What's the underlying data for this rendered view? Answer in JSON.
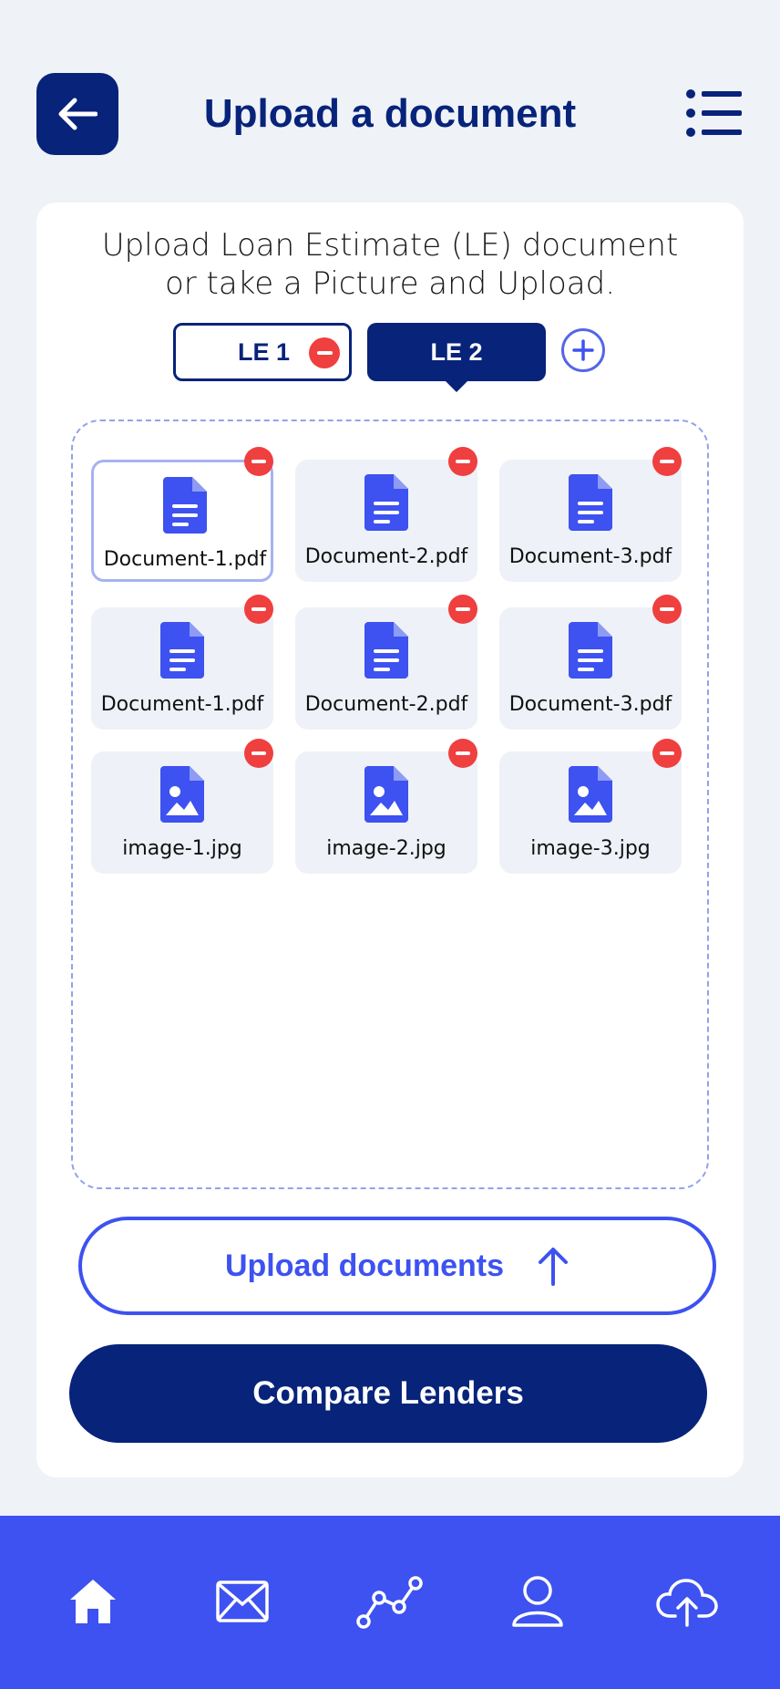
{
  "header": {
    "title": "Upload a document"
  },
  "card": {
    "instruction_line1": "Upload Loan Estimate (LE) document",
    "instruction_line2": "or take a Picture and Upload."
  },
  "tabs": [
    {
      "label": "LE 1",
      "active": false
    },
    {
      "label": "LE 2",
      "active": true
    }
  ],
  "files": [
    {
      "name": "Document-1.pdf",
      "type": "pdf",
      "selected": true
    },
    {
      "name": "Document-2.pdf",
      "type": "pdf",
      "selected": false
    },
    {
      "name": "Document-3.pdf",
      "type": "pdf",
      "selected": false
    },
    {
      "name": "Document-1.pdf",
      "type": "pdf",
      "selected": false
    },
    {
      "name": "Document-2.pdf",
      "type": "pdf",
      "selected": false
    },
    {
      "name": "Document-3.pdf",
      "type": "pdf",
      "selected": false
    },
    {
      "name": "image-1.jpg",
      "type": "image",
      "selected": false
    },
    {
      "name": "image-2.jpg",
      "type": "image",
      "selected": false
    },
    {
      "name": "image-3.jpg",
      "type": "image",
      "selected": false
    }
  ],
  "buttons": {
    "upload_label": "Upload documents",
    "compare_label": "Compare Lenders"
  },
  "nav": [
    {
      "icon": "home-icon"
    },
    {
      "icon": "mail-icon"
    },
    {
      "icon": "chart-icon"
    },
    {
      "icon": "profile-icon"
    },
    {
      "icon": "cloud-upload-icon"
    }
  ],
  "colors": {
    "navy": "#07237a",
    "accent": "#3d52f0",
    "danger": "#ef3f3f",
    "background": "#eff2f7",
    "file_icon": "#3d52f0"
  }
}
